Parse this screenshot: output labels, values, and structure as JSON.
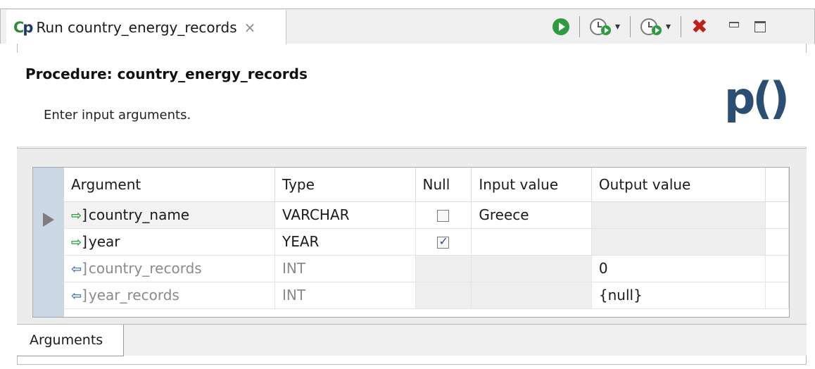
{
  "tab": {
    "icon_text": "Cp",
    "label": "Run country_energy_records",
    "close_glyph": "×"
  },
  "toolbar": {
    "run_icon": "run-icon",
    "run_with_options_icon": "run-options-icon",
    "debug_icon": "run-history-icon",
    "dropdown_glyph": "▾",
    "stop_glyph": "✖",
    "minimize_icon": "minimize-icon",
    "maximize_icon": "maximize-icon"
  },
  "header": {
    "title": "Procedure: country_energy_records",
    "subtitle": "Enter input arguments.",
    "logo_text": "p()"
  },
  "table": {
    "columns": [
      "Argument",
      "Type",
      "Null",
      "Input value",
      "Output value"
    ],
    "rows": [
      {
        "direction": "in",
        "arrow": "⇨",
        "bracket": "]",
        "name": "country_name",
        "type": "VARCHAR",
        "null": false,
        "input": "Greece",
        "output": ""
      },
      {
        "direction": "in",
        "arrow": "⇨",
        "bracket": "]",
        "name": "year",
        "type": "YEAR",
        "null": true,
        "input": "",
        "output": ""
      },
      {
        "direction": "out",
        "arrow": "⇦",
        "bracket": "]",
        "name": "country_records",
        "type": "INT",
        "null": null,
        "input": "",
        "output": "0"
      },
      {
        "direction": "out",
        "arrow": "⇦",
        "bracket": "]",
        "name": "year_records",
        "type": "INT",
        "null": null,
        "input": "",
        "output": "{null}"
      }
    ]
  },
  "bottom_tabs": {
    "arguments_label": "Arguments"
  },
  "colors": {
    "accent_green": "#2e9c3e",
    "stop_red": "#c0201a",
    "logo_blue": "#2a4f73",
    "row_header": "#cbd8e3"
  }
}
